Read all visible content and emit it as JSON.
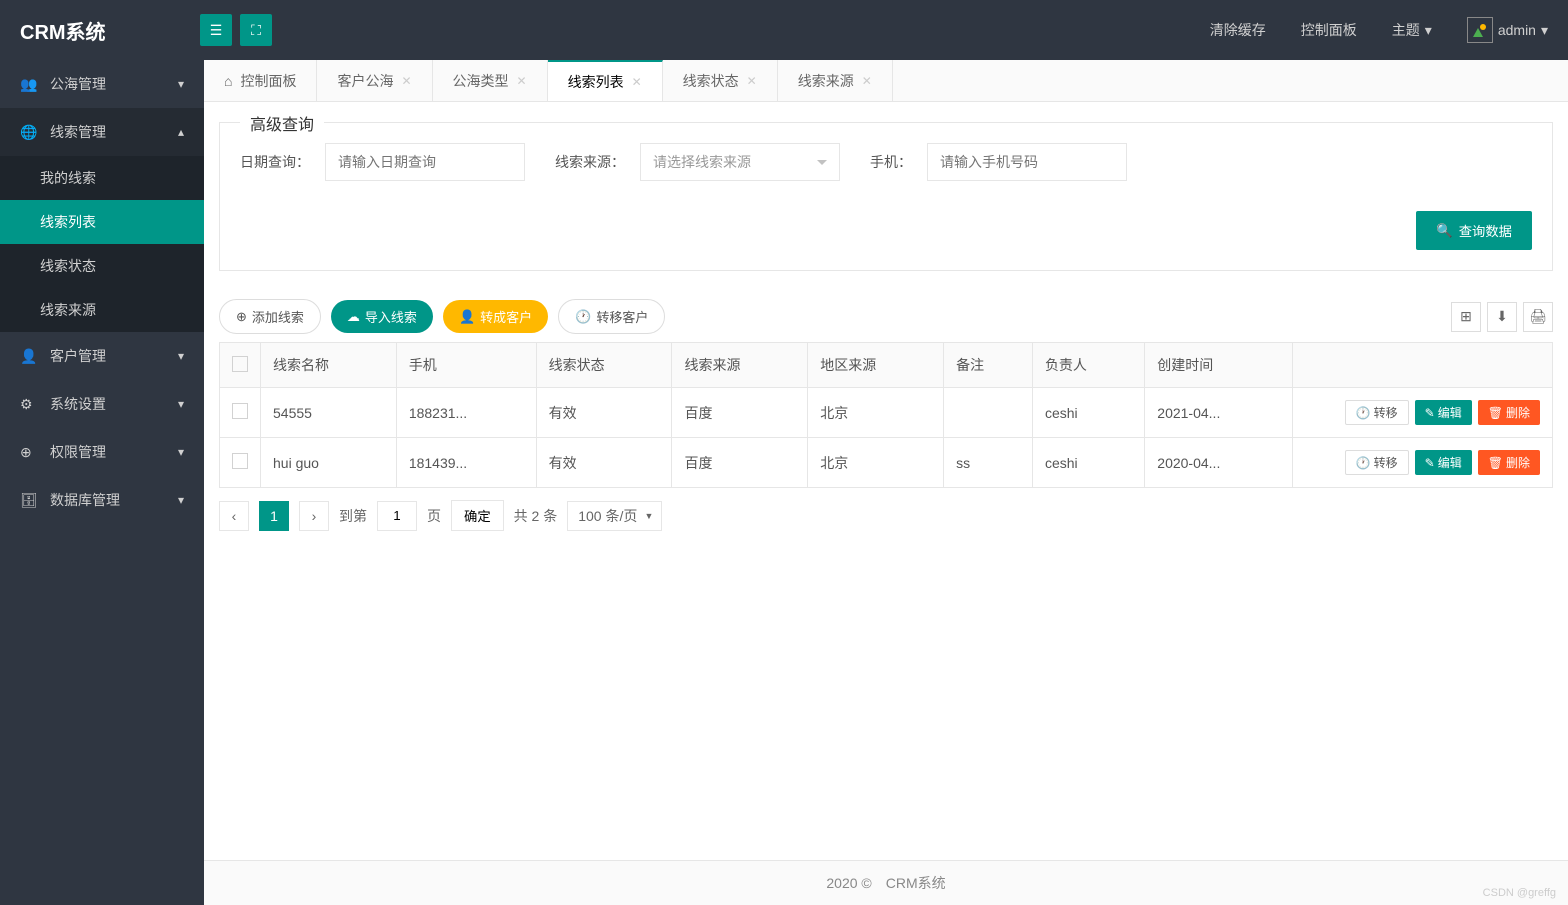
{
  "header": {
    "logo": "CRM系统",
    "right": {
      "clear_cache": "清除缓存",
      "control_panel": "控制面板",
      "theme": "主题",
      "username": "admin"
    }
  },
  "sidebar": {
    "items": [
      {
        "label": "公海管理",
        "icon": "👥"
      },
      {
        "label": "线索管理",
        "icon": "🌐",
        "expanded": true,
        "children": [
          {
            "label": "我的线索"
          },
          {
            "label": "线索列表",
            "active": true
          },
          {
            "label": "线索状态"
          },
          {
            "label": "线索来源"
          }
        ]
      },
      {
        "label": "客户管理",
        "icon": "👤"
      },
      {
        "label": "系统设置",
        "icon": "⚙"
      },
      {
        "label": "权限管理",
        "icon": "⊕"
      },
      {
        "label": "数据库管理",
        "icon": "🗄"
      }
    ]
  },
  "tabs": [
    {
      "label": "控制面板",
      "home": true
    },
    {
      "label": "客户公海"
    },
    {
      "label": "公海类型"
    },
    {
      "label": "线索列表",
      "active": true
    },
    {
      "label": "线索状态"
    },
    {
      "label": "线索来源"
    }
  ],
  "search": {
    "title": "高级查询",
    "date_label": "日期查询：",
    "date_placeholder": "请输入日期查询",
    "source_label": "线索来源：",
    "source_placeholder": "请选择线索来源",
    "phone_label": "手机：",
    "phone_placeholder": "请输入手机号码",
    "query_btn": "查询数据"
  },
  "toolbar": {
    "add": "添加线索",
    "import": "导入线索",
    "convert": "转成客户",
    "transfer": "转移客户"
  },
  "table": {
    "headers": [
      "线索名称",
      "手机",
      "线索状态",
      "线索来源",
      "地区来源",
      "备注",
      "负责人",
      "创建时间"
    ],
    "rows": [
      {
        "cells": [
          "54555",
          "188231...",
          "有效",
          "百度",
          "北京",
          "",
          "ceshi",
          "2021-04..."
        ]
      },
      {
        "cells": [
          "hui guo",
          "181439...",
          "有效",
          "百度",
          "北京",
          "ss",
          "ceshi",
          "2020-04..."
        ]
      }
    ],
    "actions": {
      "transfer": "转移",
      "edit": "编辑",
      "delete": "删除"
    }
  },
  "pagination": {
    "current": "1",
    "goto_label": "到第",
    "goto_value": "1",
    "page_label": "页",
    "confirm": "确定",
    "total": "共 2 条",
    "per_page": "100 条/页"
  },
  "footer": "2020 ©　CRM系统",
  "watermark": "CSDN @greffg"
}
